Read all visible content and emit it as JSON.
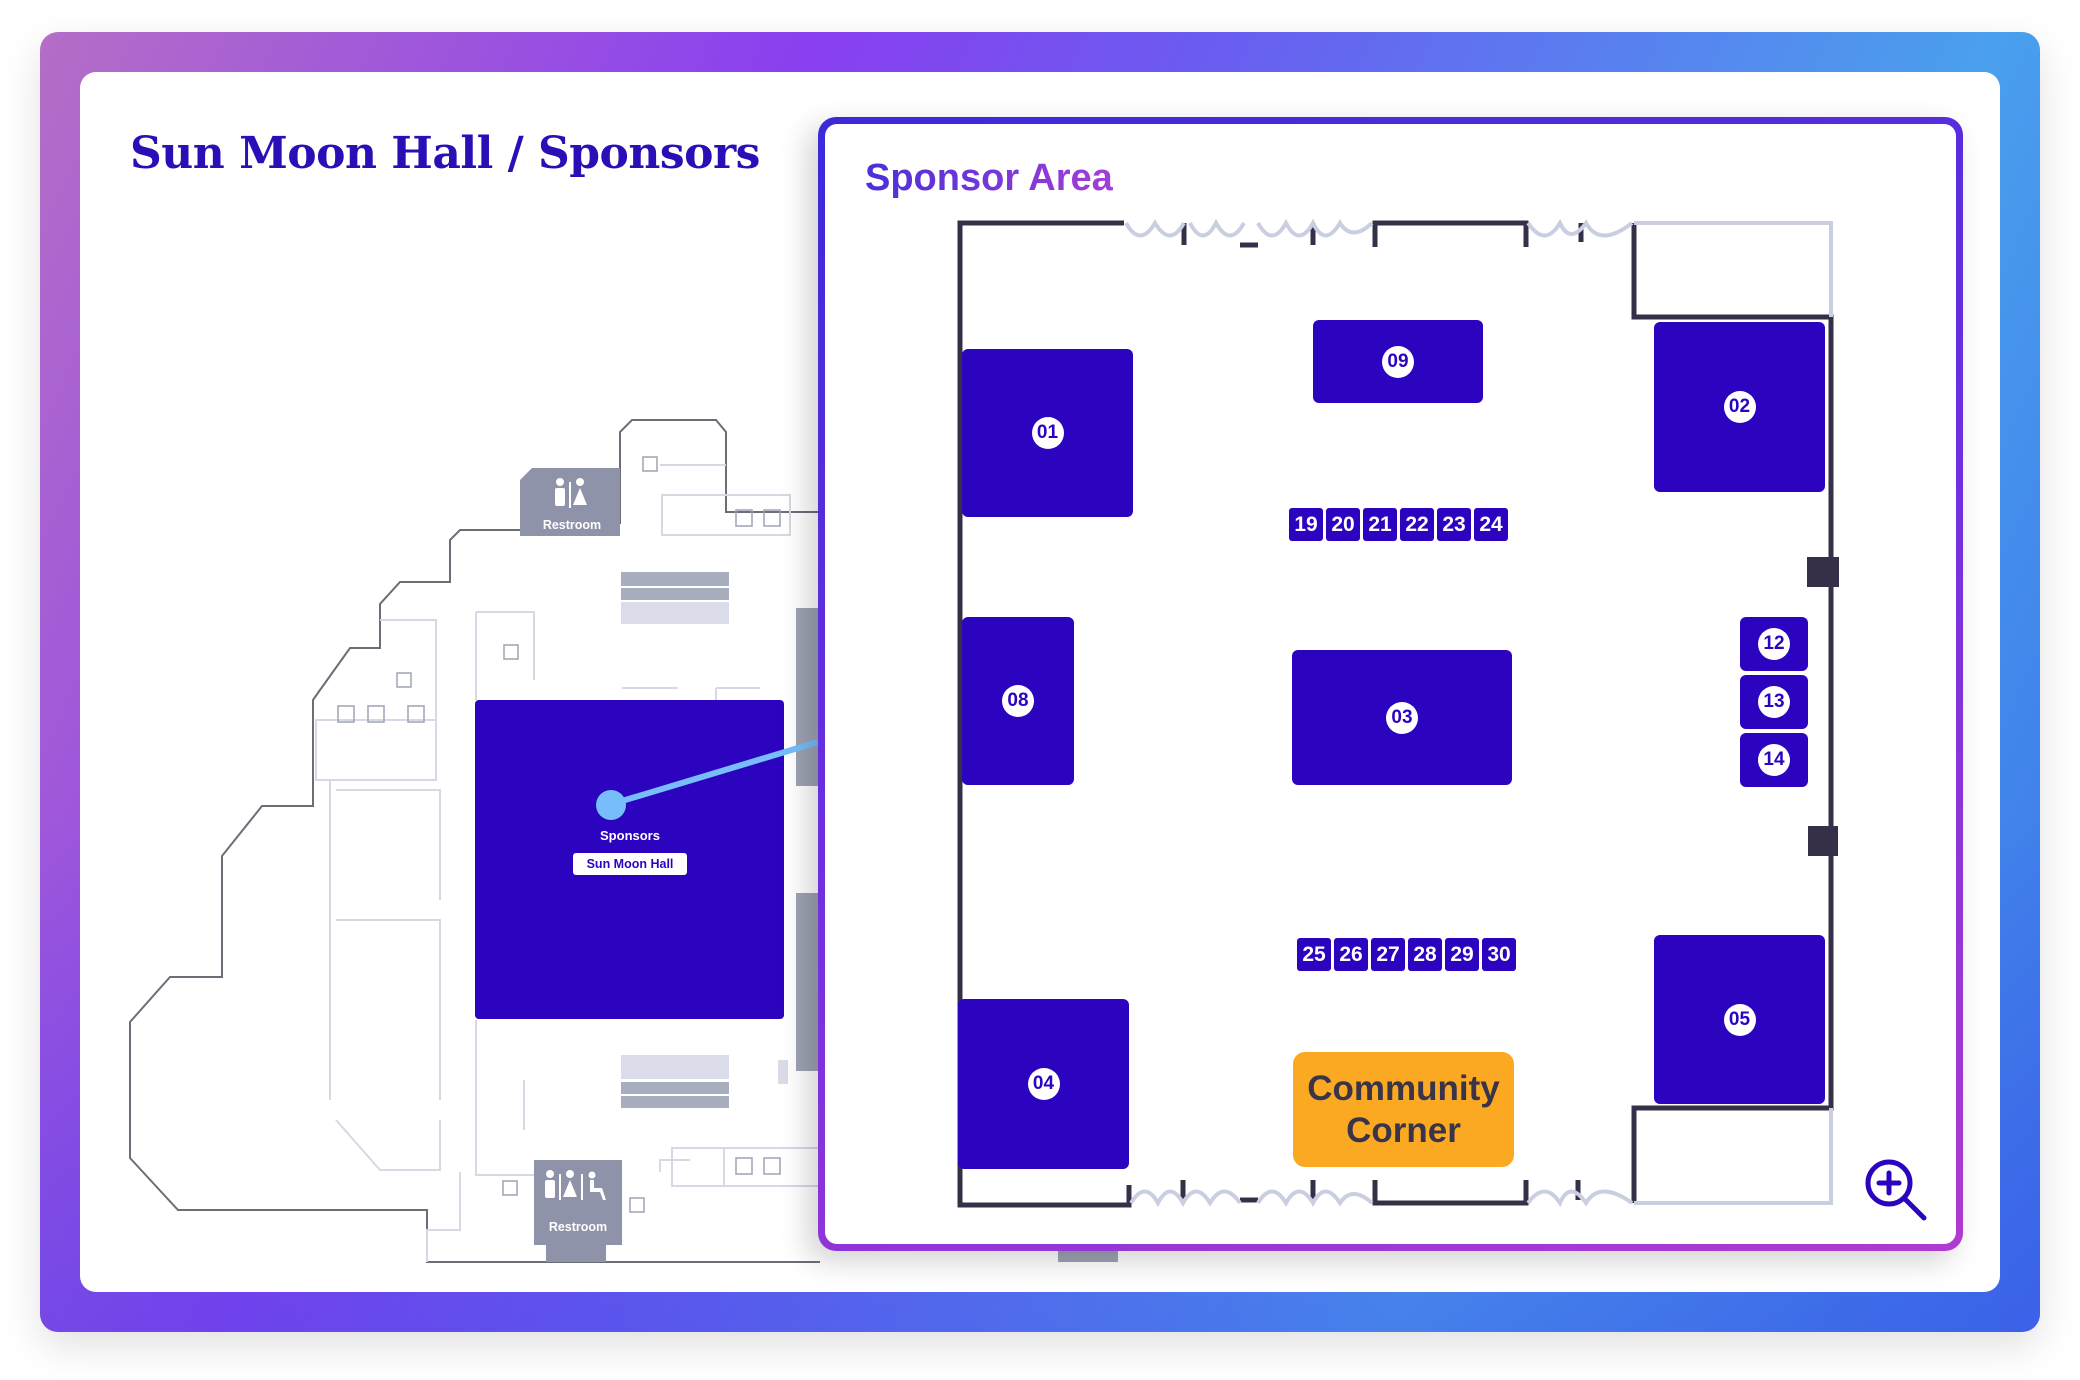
{
  "page": {
    "title": "Sun Moon Hall / Sponsors"
  },
  "floor_plan": {
    "highlighted_room": {
      "label": "Sponsors",
      "tag": "Sun Moon Hall",
      "color": "#2c04c0",
      "marker_color": "#76bdfa"
    },
    "restrooms": [
      {
        "label": "Restroom",
        "icons": [
          "male-icon",
          "female-icon"
        ]
      },
      {
        "label": "Restroom",
        "icons": [
          "male-icon",
          "female-icon",
          "accessible-icon"
        ]
      }
    ],
    "amenity_icons": [
      "emergency-exit-icon",
      "elevator-icon",
      "escalator-icon"
    ]
  },
  "detail_panel": {
    "title": "Sponsor Area",
    "booth_color": "#2c04c0",
    "booths": [
      {
        "id": "01"
      },
      {
        "id": "02"
      },
      {
        "id": "03"
      },
      {
        "id": "04"
      },
      {
        "id": "05"
      },
      {
        "id": "08"
      },
      {
        "id": "09"
      },
      {
        "id": "12"
      },
      {
        "id": "13"
      },
      {
        "id": "14"
      }
    ],
    "table_row_top": [
      "19",
      "20",
      "21",
      "22",
      "23",
      "24"
    ],
    "table_row_bottom": [
      "25",
      "26",
      "27",
      "28",
      "29",
      "30"
    ],
    "community_corner": {
      "line1": "Community",
      "line2": "Corner",
      "color": "#fba922"
    },
    "zoom_button": "zoom-in-icon"
  }
}
